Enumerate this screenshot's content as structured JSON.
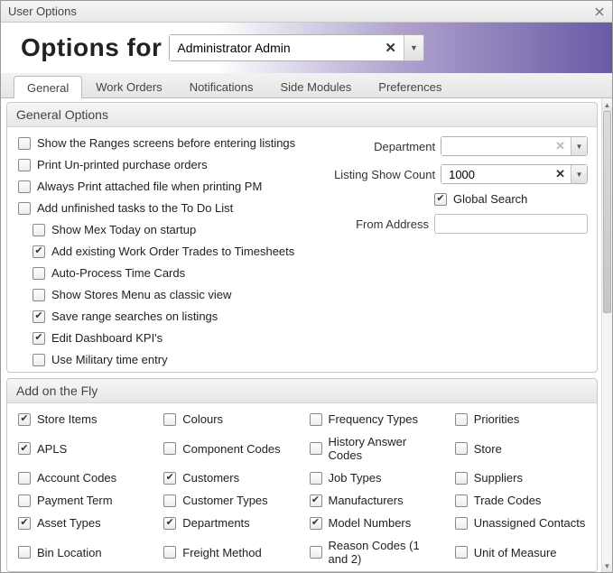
{
  "titlebar": {
    "title": "User Options"
  },
  "header": {
    "title": "Options for",
    "user_field": "Administrator Admin"
  },
  "tabs": [
    "General",
    "Work Orders",
    "Notifications",
    "Side Modules",
    "Preferences"
  ],
  "general": {
    "title": "General Options",
    "checks": [
      {
        "label": "Show the Ranges screens before entering listings",
        "checked": false,
        "indent": false
      },
      {
        "label": "Print Un-printed purchase orders",
        "checked": false,
        "indent": false
      },
      {
        "label": "Always Print attached file when printing PM",
        "checked": false,
        "indent": false
      },
      {
        "label": "Add unfinished tasks to the To Do List",
        "checked": false,
        "indent": false
      },
      {
        "label": "Show Mex Today on startup",
        "checked": false,
        "indent": true
      },
      {
        "label": "Add existing Work Order Trades to Timesheets",
        "checked": true,
        "indent": true
      },
      {
        "label": "Auto-Process Time Cards",
        "checked": false,
        "indent": true
      },
      {
        "label": "Show Stores Menu as classic view",
        "checked": false,
        "indent": true
      },
      {
        "label": "Save range searches on listings",
        "checked": true,
        "indent": true
      },
      {
        "label": "Edit Dashboard KPI's",
        "checked": true,
        "indent": true
      },
      {
        "label": "Use Military time entry",
        "checked": false,
        "indent": true
      }
    ],
    "right": {
      "department_label": "Department",
      "department_value": "",
      "listing_label": "Listing Show Count",
      "listing_value": "1000",
      "global_search": {
        "label": "Global Search",
        "checked": true
      },
      "from_address_label": "From Address",
      "from_address_value": ""
    }
  },
  "addfly": {
    "title": "Add on the Fly",
    "items": [
      {
        "label": "Store Items",
        "checked": true
      },
      {
        "label": "Colours",
        "checked": false
      },
      {
        "label": "Frequency Types",
        "checked": false
      },
      {
        "label": "Priorities",
        "checked": false
      },
      {
        "label": "APLS",
        "checked": true
      },
      {
        "label": "Component Codes",
        "checked": false
      },
      {
        "label": "History Answer Codes",
        "checked": false
      },
      {
        "label": "Store",
        "checked": false
      },
      {
        "label": "Account Codes",
        "checked": false
      },
      {
        "label": "Customers",
        "checked": true
      },
      {
        "label": "Job Types",
        "checked": false
      },
      {
        "label": "Suppliers",
        "checked": false
      },
      {
        "label": "Payment Term",
        "checked": false
      },
      {
        "label": "Customer Types",
        "checked": false
      },
      {
        "label": "Manufacturers",
        "checked": true
      },
      {
        "label": "Trade Codes",
        "checked": false
      },
      {
        "label": "Asset Types",
        "checked": true
      },
      {
        "label": "Departments",
        "checked": true
      },
      {
        "label": "Model Numbers",
        "checked": true
      },
      {
        "label": "Unassigned Contacts",
        "checked": false
      },
      {
        "label": "Bin Location",
        "checked": false
      },
      {
        "label": "Freight Method",
        "checked": false
      },
      {
        "label": "Reason Codes (1 and 2)",
        "checked": false
      },
      {
        "label": "Unit of Measure",
        "checked": false
      }
    ]
  }
}
